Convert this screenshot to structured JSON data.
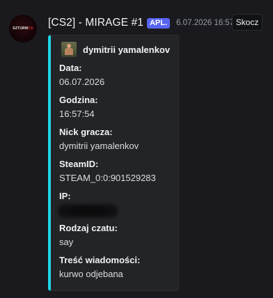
{
  "message": {
    "bot_name": "[CS2] - MIRAGE #1",
    "app_badge": "APL.",
    "timestamp": "6.07.2026 16:57",
    "jump_label": "Skocz",
    "avatar": {
      "text_white": "SZTURM",
      "text_red": "CS"
    },
    "embed": {
      "accent_color": "#1cd6e6",
      "author_name": "dymitrii yamalenkov",
      "fields": [
        {
          "name": "Data:",
          "value": "06.07.2026"
        },
        {
          "name": "Godzina:",
          "value": "16:57:54"
        },
        {
          "name": "Nick gracza:",
          "value": "dymitrii yamalenkov"
        },
        {
          "name": "SteamID:",
          "value": "STEAM_0:0:901529283"
        },
        {
          "name": "IP:",
          "value": ""
        },
        {
          "name": "Rodzaj czatu:",
          "value": "say"
        },
        {
          "name": "Treść wiadomości:",
          "value": "kurwo odjebana"
        }
      ]
    }
  }
}
